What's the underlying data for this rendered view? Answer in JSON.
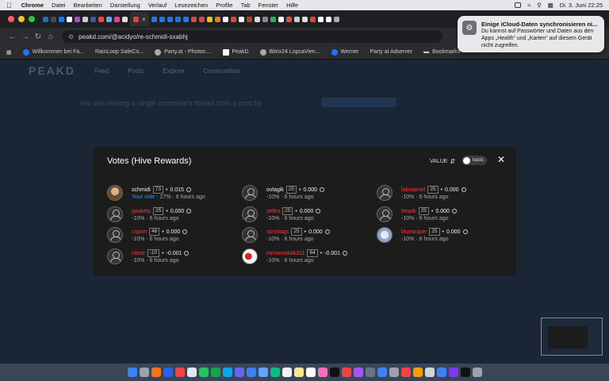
{
  "menubar": {
    "app": "Chrome",
    "items": [
      "Datei",
      "Bearbeiten",
      "Darstellung",
      "Verlauf",
      "Lesezeichen",
      "Profile",
      "Tab",
      "Fenster",
      "Hilfe"
    ],
    "datetime": "Di. 3. Juni  22:25"
  },
  "addressbar": {
    "url": "peakd.com/@acidyo/re-schmidi-sxabhj"
  },
  "bookmarks": [
    "Willkommen bei Fa...",
    "RainLoop SafeCo...",
    "Party.at - Photos:...",
    "PeakD",
    "Bitrix24 LopcaVien...",
    "Werner",
    "Party at Adserver",
    "Bookmarks"
  ],
  "notification": {
    "title": "Einige iCloud-Daten synchronisieren ni...",
    "body": "Du kannst auf Passwörter und Daten aus den Apps „Health“ und „Karten“ auf diesem Gerät nicht zugreifen."
  },
  "page": {
    "logo": "PEAKD",
    "nav": [
      "Feed",
      "Posts",
      "Explore",
      "Communities"
    ],
    "notice": "You are viewing a single comment's thread from a post by"
  },
  "modal": {
    "title": "Votes (Hive Rewards)",
    "sort_label": "VALUE",
    "toggle_label": "basic",
    "your_vote_label": "Your vote",
    "votes": [
      {
        "user": "schmidi",
        "rep": "73",
        "amount": "0.015",
        "meta": "27% · 6 hours ago",
        "your_vote": true,
        "highlight": false
      },
      {
        "user": "gaskets",
        "rep": "25",
        "amount": "0.000",
        "meta": "-10% · 6 hours ago",
        "highlight": true
      },
      {
        "user": "csport",
        "rep": "46",
        "amount": "0.000",
        "meta": "-10% · 6 hours ago",
        "highlight": true
      },
      {
        "user": "ctime",
        "rep": "-10",
        "amount": "-0.001",
        "meta": "-10% · 6 hours ago",
        "highlight": true
      },
      {
        "user": "ovlagik",
        "rep": "25",
        "amount": "0.000",
        "meta": "-10% · 6 hours ago",
        "highlight": false
      },
      {
        "user": "zeltra",
        "rep": "25",
        "amount": "0.000",
        "meta": "-10% · 6 hours ago",
        "highlight": true
      },
      {
        "user": "sonntags",
        "rep": "25",
        "amount": "0.000",
        "meta": "-10% · 6 hours ago",
        "highlight": true
      },
      {
        "user": "mmmmkkkk311",
        "rep": "64",
        "amount": "-0.001",
        "meta": "-10% · 6 hours ago",
        "highlight": true
      },
      {
        "user": "labutamol",
        "rep": "25",
        "amount": "0.000",
        "meta": "-10% · 6 hours ago",
        "highlight": true
      },
      {
        "user": "tenpik",
        "rep": "25",
        "amount": "0.000",
        "meta": "-10% · 6 hours ago",
        "highlight": true
      },
      {
        "user": "bluesniper",
        "rep": "25",
        "amount": "0.000",
        "meta": "-10% · 6 hours ago",
        "highlight": true
      }
    ]
  }
}
